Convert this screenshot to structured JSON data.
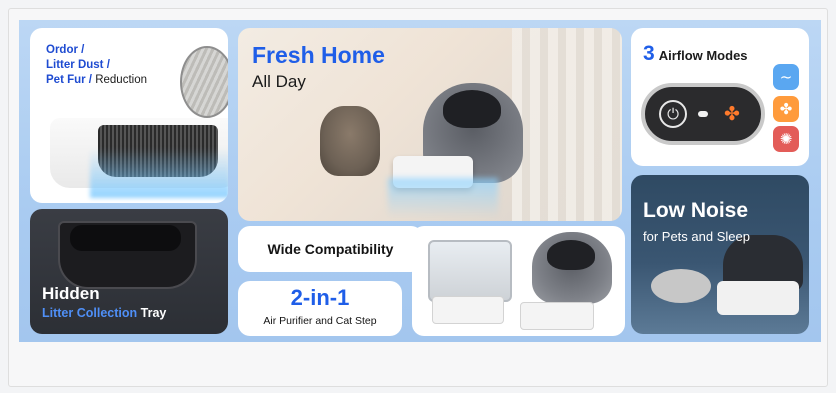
{
  "banner": {
    "odor_panel": {
      "line1": "Ordor /",
      "line2": "Litter Dust /",
      "line3_a": "Pet Fur /",
      "line3_b": " Reduction"
    },
    "fresh_panel": {
      "title": "Fresh Home",
      "subtitle": "All Day"
    },
    "airflow_panel": {
      "number": "3",
      "title": "Airflow Modes",
      "power_icon": "power-icon",
      "fan_icon": "fan-icon",
      "modes": [
        {
          "icon": "breeze-mode-icon",
          "color": "#5aa7f1"
        },
        {
          "icon": "fan-mode-icon",
          "color": "#ff9b3c"
        },
        {
          "icon": "strong-fan-mode-icon",
          "color": "#e35c58"
        }
      ]
    },
    "hidden_panel": {
      "title": "Hidden",
      "sub_blue": "Litter Collection",
      "sub_white": " Tray"
    },
    "wide_panel": {
      "title": "Wide Compatibility"
    },
    "twoin_panel": {
      "title": "2-in-1",
      "subtitle": "Air Purifier and Cat Step"
    },
    "noise_panel": {
      "title": "Low Noise",
      "subtitle": "for Pets and Sleep"
    }
  }
}
